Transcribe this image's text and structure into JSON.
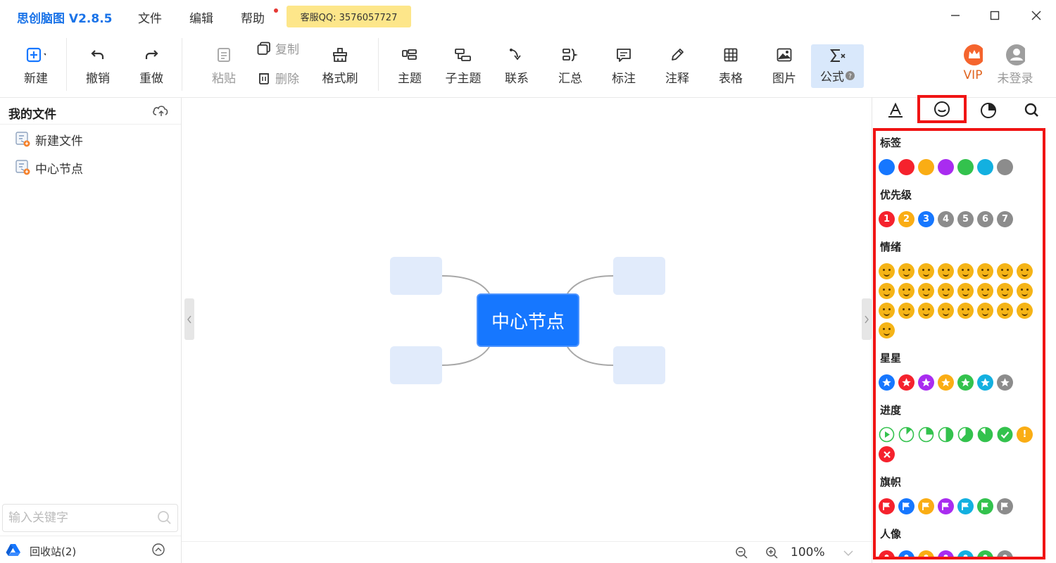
{
  "app": {
    "title": "思创脑图 V2.8.5",
    "qq_badge": "客服QQ: 3576057727"
  },
  "menu": {
    "file": "文件",
    "edit": "编辑",
    "help": "帮助"
  },
  "toolbar": {
    "new": "新建",
    "undo": "撤销",
    "redo": "重做",
    "paste": "粘贴",
    "copy": "复制",
    "delete": "删除",
    "format_brush": "格式刷",
    "topic": "主题",
    "subtopic": "子主题",
    "relation": "联系",
    "summary": "汇总",
    "callout": "标注",
    "note": "注释",
    "table": "表格",
    "image": "图片",
    "formula": "公式",
    "vip": "VIP",
    "login": "未登录"
  },
  "sidebar": {
    "title": "我的文件",
    "files": [
      {
        "label": "新建文件"
      },
      {
        "label": "中心节点"
      }
    ],
    "search_placeholder": "输入关键字",
    "recycle": "回收站(2)"
  },
  "canvas": {
    "center_node": "中心节点",
    "zoom": "100%"
  },
  "panel": {
    "sections": {
      "tags": "标签",
      "priority": "优先级",
      "emotion": "情绪",
      "star": "星星",
      "progress": "进度",
      "flag": "旗帜",
      "people": "人像"
    },
    "tag_colors": [
      "#1677ff",
      "#f5222d",
      "#faad14",
      "#a92cf0",
      "#33c24d",
      "#13b0e0",
      "#8c8c8c"
    ],
    "priority_labels": [
      "1",
      "2",
      "3",
      "4",
      "5",
      "6",
      "7"
    ],
    "priority_colors": [
      "#f5222d",
      "#faad14",
      "#1677ff",
      "#8c8c8c",
      "#8c8c8c",
      "#8c8c8c",
      "#8c8c8c"
    ],
    "star_colors": [
      "#1677ff",
      "#f5222d",
      "#a92cf0",
      "#faad14",
      "#33c24d",
      "#13b0e0",
      "#8c8c8c"
    ],
    "flag_colors": [
      "#f5222d",
      "#1677ff",
      "#faad14",
      "#a92cf0",
      "#13b0e0",
      "#33c24d",
      "#8c8c8c"
    ],
    "people_colors": [
      "#f5222d",
      "#1677ff",
      "#faad14",
      "#a92cf0",
      "#13b0e0",
      "#33c24d",
      "#8c8c8c"
    ],
    "progress_steps": [
      0,
      0.125,
      0.25,
      0.5,
      0.625,
      0.875,
      1
    ],
    "colors": {
      "red_highlight": "#f01414",
      "accent": "#1677ff"
    }
  }
}
